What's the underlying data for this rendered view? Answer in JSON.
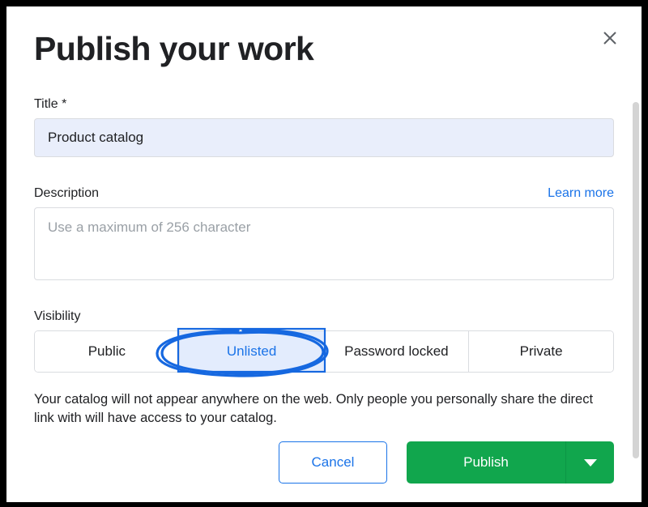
{
  "dialog": {
    "title": "Publish your work",
    "close_icon": "close-icon"
  },
  "title_field": {
    "label": "Title *",
    "value": "Product catalog",
    "placeholder": ""
  },
  "description_field": {
    "label": "Description",
    "value": "",
    "placeholder": "Use a maximum of 256 character",
    "learn_more_label": "Learn more"
  },
  "visibility": {
    "label": "Visibility",
    "options": [
      {
        "label": "Public",
        "selected": false
      },
      {
        "label": "Unlisted",
        "selected": true
      },
      {
        "label": "Password locked",
        "selected": false
      },
      {
        "label": "Private",
        "selected": false
      }
    ],
    "selected_value": "Unlisted",
    "helper_text": "Your catalog will not appear anywhere on the web. Only people you personally share the direct link with will have access to your catalog."
  },
  "actions": {
    "cancel_label": "Cancel",
    "publish_label": "Publish",
    "publish_more_icon": "chevron-down-icon"
  },
  "colors": {
    "accent_blue": "#1a73e8",
    "publish_green": "#11a64d",
    "selected_segment_bg": "#e3ecfd",
    "title_input_bg": "#e9eefb",
    "annotation_blue": "#1668e0"
  }
}
